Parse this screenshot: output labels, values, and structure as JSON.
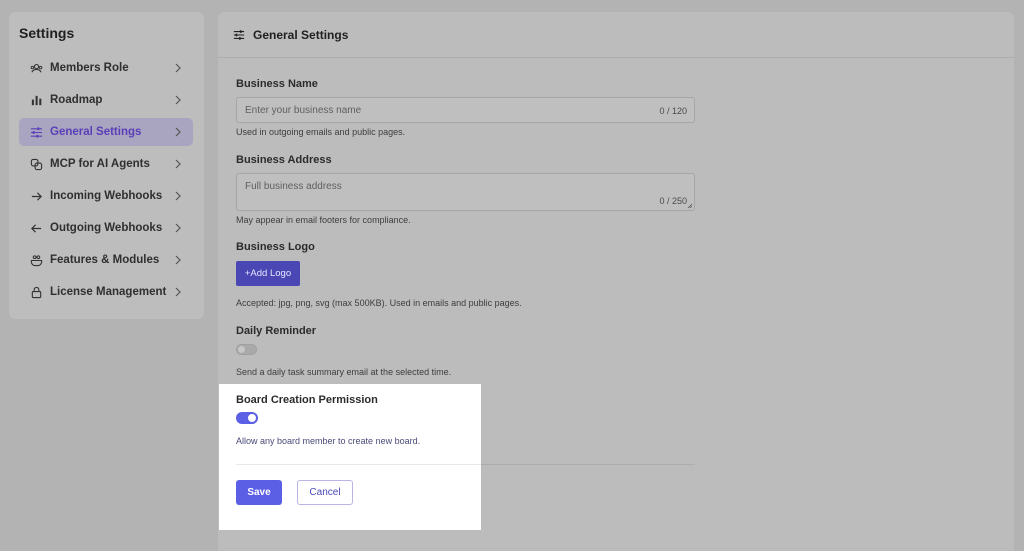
{
  "sidebar": {
    "title": "Settings",
    "items": [
      {
        "label": "Members Role",
        "icon": "members-icon"
      },
      {
        "label": "Roadmap",
        "icon": "bar-chart-icon"
      },
      {
        "label": "General Settings",
        "icon": "sliders-icon",
        "active": true
      },
      {
        "label": "MCP for AI Agents",
        "icon": "mcp-icon"
      },
      {
        "label": "Incoming Webhooks",
        "icon": "arrow-right-icon"
      },
      {
        "label": "Outgoing Webhooks",
        "icon": "arrow-left-icon"
      },
      {
        "label": "Features & Modules",
        "icon": "modules-icon"
      },
      {
        "label": "License Management",
        "icon": "lock-icon"
      }
    ]
  },
  "main": {
    "title": "General Settings",
    "business_name": {
      "label": "Business Name",
      "placeholder": "Enter your business name",
      "count": "0 / 120",
      "hint": "Used in outgoing emails and public pages."
    },
    "business_address": {
      "label": "Business Address",
      "placeholder": "Full business address",
      "count": "0 / 250",
      "hint": "May appear in email footers for compliance."
    },
    "business_logo": {
      "label": "Business Logo",
      "button": "+Add Logo",
      "hint": "Accepted: jpg, png, svg (max 500KB). Used in emails and public pages."
    },
    "daily_reminder": {
      "label": "Daily Reminder",
      "enabled": false,
      "hint": "Send a daily task summary email at the selected time."
    },
    "board_permission": {
      "label": "Board Creation Permission",
      "enabled": true,
      "hint": "Allow any board member to create new board."
    },
    "actions": {
      "save": "Save",
      "cancel": "Cancel"
    }
  },
  "colors": {
    "accent": "#5b5fe6",
    "active_text": "#5a3fb8"
  }
}
